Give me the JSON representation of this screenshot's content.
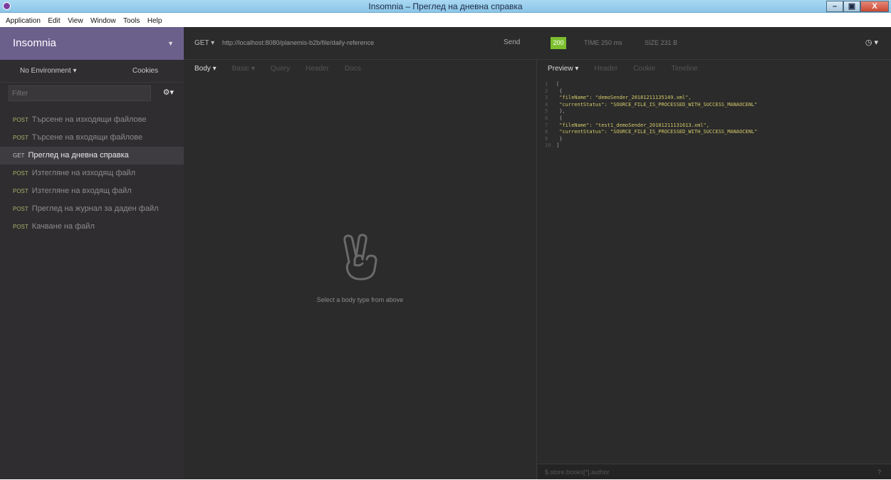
{
  "window": {
    "title": "Insomnia – Преглед на дневна справка",
    "minimize": "–",
    "maximize": "▣",
    "close": "X"
  },
  "menu": [
    "Application",
    "Edit",
    "View",
    "Window",
    "Tools",
    "Help"
  ],
  "sidebar": {
    "workspace": "Insomnia",
    "environment": "No Environment ▾",
    "cookies": "Cookies",
    "filter_placeholder": "Filter",
    "requests": [
      {
        "method": "POST",
        "name": "Търсене на изходящи файлове",
        "active": false
      },
      {
        "method": "POST",
        "name": "Търсене на входящи файлове",
        "active": false
      },
      {
        "method": "GET",
        "name": "Преглед на дневна справка",
        "active": true
      },
      {
        "method": "POST",
        "name": "Изтегляне на изходящ файл",
        "active": false
      },
      {
        "method": "POST",
        "name": "Изтегляне на входящ файл",
        "active": false
      },
      {
        "method": "POST",
        "name": "Преглед на журнал за даден файл",
        "active": false
      },
      {
        "method": "POST",
        "name": "Качване на файл",
        "active": false
      }
    ]
  },
  "urlbar": {
    "method": "GET ▾",
    "url": "http://localhost:8080/planemis-b2b/file/daily-reference",
    "send": "Send",
    "status": "200",
    "time": "TIME 250 ms",
    "size": "SIZE 231 B"
  },
  "request": {
    "tabs": [
      "Body ▾",
      "Basic ▾",
      "Query",
      "Header",
      "Docs"
    ],
    "empty_message": "Select a body type from above"
  },
  "response": {
    "tabs": [
      "Preview ▾",
      "Header",
      "Cookie",
      "Timeline"
    ],
    "lines": [
      {
        "n": "1",
        "t": "["
      },
      {
        "n": "2",
        "t": "  {"
      },
      {
        "n": "3",
        "t": "    \"fileName\": \"demoSender_20181211135149.xml\","
      },
      {
        "n": "4",
        "t": "    \"currentStatus\": \"SOURCE_FILE_IS_PROCESSED_WITH_SUCCESS_MANAOCENL\""
      },
      {
        "n": "5",
        "t": "  },"
      },
      {
        "n": "6",
        "t": "  {"
      },
      {
        "n": "7",
        "t": "    \"fileName\": \"test1_demoSender_20181211131613.xml\","
      },
      {
        "n": "8",
        "t": "    \"currentStatus\": \"SOURCE_FILE_IS_PROCESSED_WITH_SUCCESS_MANAOCENL\""
      },
      {
        "n": "9",
        "t": "  }"
      },
      {
        "n": "10",
        "t": "]"
      }
    ],
    "filter_placeholder": "$.store.books[*].author",
    "help": "?"
  },
  "colors": {
    "workspace": "#6b5f8c",
    "status_ok": "#7cbf2e"
  }
}
